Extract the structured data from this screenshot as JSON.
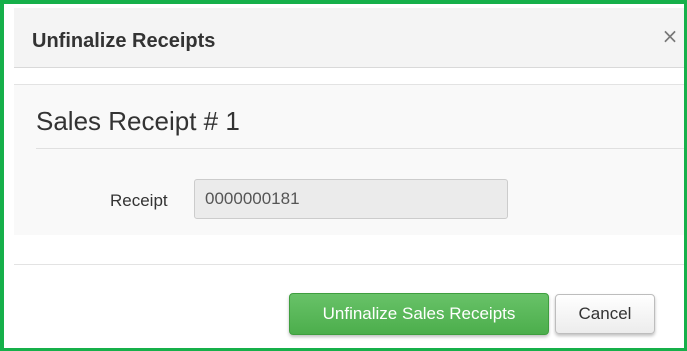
{
  "dialog": {
    "title": "Unfinalize Receipts",
    "close_glyph": "×",
    "close_icon": "close-icon"
  },
  "body": {
    "section_title": "Sales Receipt # 1",
    "receipt_label": "Receipt",
    "receipt_value": "0000000181"
  },
  "footer": {
    "primary_label": "Unfinalize Sales Receipts",
    "cancel_label": "Cancel"
  },
  "colors": {
    "frame_border": "#16b04a",
    "primary_button": "#5cb85c",
    "header_background": "#f4f4f4",
    "input_background": "#ebebeb"
  }
}
